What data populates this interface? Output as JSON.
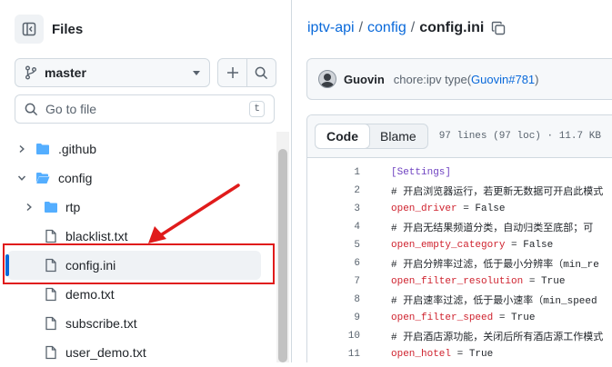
{
  "sidebar": {
    "title": "Files",
    "branch": "master",
    "search_placeholder": "Go to file",
    "search_shortcut": "t",
    "tree": [
      {
        "name": ".github",
        "type": "dir",
        "expanded": false,
        "depth": 0
      },
      {
        "name": "config",
        "type": "dir",
        "expanded": true,
        "depth": 0
      },
      {
        "name": "rtp",
        "type": "dir",
        "expanded": false,
        "depth": 1
      },
      {
        "name": "blacklist.txt",
        "type": "file",
        "depth": 1
      },
      {
        "name": "config.ini",
        "type": "file",
        "depth": 1,
        "selected": true
      },
      {
        "name": "demo.txt",
        "type": "file",
        "depth": 1
      },
      {
        "name": "subscribe.txt",
        "type": "file",
        "depth": 1
      },
      {
        "name": "user_demo.txt",
        "type": "file",
        "depth": 1
      }
    ]
  },
  "breadcrumb": {
    "repo": "iptv-api",
    "sep1": "/",
    "folder": "config",
    "sep2": "/",
    "file": "config.ini"
  },
  "commit": {
    "author": "Guovin",
    "message": "chore:ipv type(",
    "ref": "Guovin#781",
    "message_end": ")"
  },
  "file": {
    "tab_code": "Code",
    "tab_blame": "Blame",
    "meta": "97 lines (97 loc) · 11.7 KB",
    "lines": [
      {
        "n": "1",
        "kind": "sec",
        "text": "[Settings]"
      },
      {
        "n": "2",
        "kind": "com",
        "text": "# 开启浏览器运行，若更新无数据可开启此模式"
      },
      {
        "n": "3",
        "kind": "kv",
        "key": "open_driver",
        "val": " = False"
      },
      {
        "n": "4",
        "kind": "com",
        "text": "# 开启无结果频道分类，自动归类至底部；可"
      },
      {
        "n": "5",
        "kind": "kv",
        "key": "open_empty_category",
        "val": " = False"
      },
      {
        "n": "6",
        "kind": "com",
        "text": "# 开启分辨率过滤，低于最小分辨率（min_re"
      },
      {
        "n": "7",
        "kind": "kv",
        "key": "open_filter_resolution",
        "val": " = True"
      },
      {
        "n": "8",
        "kind": "com",
        "text": "# 开启速率过滤，低于最小速率（min_speed"
      },
      {
        "n": "9",
        "kind": "kv",
        "key": "open_filter_speed",
        "val": " = True"
      },
      {
        "n": "10",
        "kind": "com",
        "text": "# 开启酒店源功能，关闭后所有酒店源工作模式"
      },
      {
        "n": "11",
        "kind": "kv",
        "key": "open_hotel",
        "val": " = True"
      }
    ]
  },
  "colors": {
    "link": "#0969da",
    "highlight": "#e01b1b",
    "section": "#6f42c1",
    "key": "#cf222e"
  }
}
